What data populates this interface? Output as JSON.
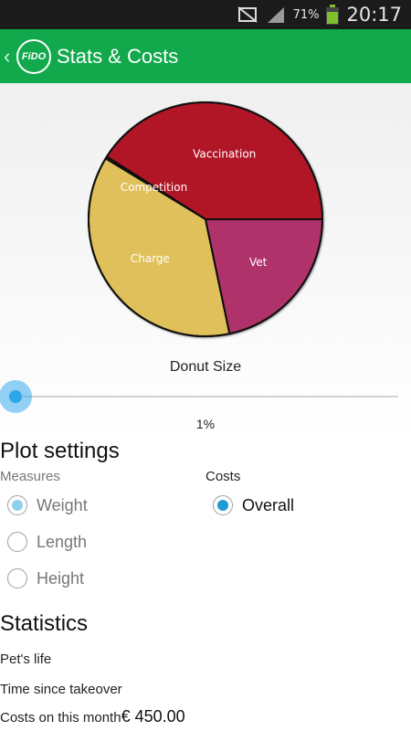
{
  "status_bar": {
    "battery_percent": "71%",
    "time": "20:17",
    "icons": [
      "mute-icon",
      "signal-icon",
      "battery-icon"
    ]
  },
  "action_bar": {
    "logo_text": "FiDO",
    "title": "Stats & Costs"
  },
  "chart_data": {
    "type": "pie",
    "categories": [
      "Vaccination",
      "Competition",
      "Charge",
      "Vet"
    ],
    "values": [
      41,
      0.3,
      37,
      21.7
    ],
    "colors": [
      "#b01428",
      "#b01428",
      "#e0c05a",
      "#b0306a"
    ],
    "legend": "none"
  },
  "slider": {
    "label": "Donut Size",
    "value_text": "1%",
    "value": 0.01
  },
  "plot_settings": {
    "title": "Plot settings",
    "measures_label": "Measures",
    "costs_label": "Costs",
    "measures": [
      {
        "label": "Weight",
        "selected": true
      },
      {
        "label": "Length",
        "selected": false
      },
      {
        "label": "Height",
        "selected": false
      }
    ],
    "costs": [
      {
        "label": "Overall",
        "selected": true
      }
    ]
  },
  "statistics": {
    "title": "Statistics",
    "pets_life_label": "Pet's life",
    "time_since_takeover_label": "Time since takeover",
    "costs_month_label": "Costs on this month",
    "costs_month_value": "€ 450.00"
  },
  "colors": {
    "action_bar": "#12a84c",
    "status_bar": "#1b1b1b",
    "accent": "#2fa6e8"
  }
}
